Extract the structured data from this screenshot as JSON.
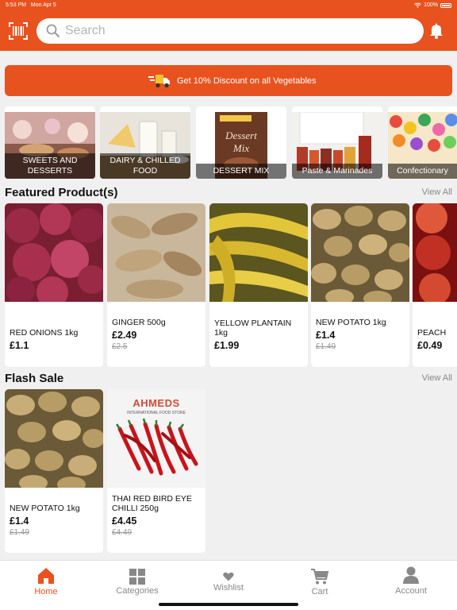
{
  "status": {
    "time": "5:53 PM",
    "date": "Mon Apr 5",
    "battery": "100%"
  },
  "search": {
    "placeholder": "Search"
  },
  "banner": {
    "text": "Get 10% Discount on all Vegetables"
  },
  "categories": [
    {
      "label": "SWEETS AND DESSERTS"
    },
    {
      "label": "DAIRY & CHILLED FOOD"
    },
    {
      "label": "DESSERT MIX"
    },
    {
      "label": "Paste & Marinades"
    },
    {
      "label": "Confectionary"
    }
  ],
  "featured": {
    "title": "Featured Product(s)",
    "view_all": "View All",
    "products": [
      {
        "name": "RED ONIONS 1kg",
        "price": "£1.1",
        "old_price": ""
      },
      {
        "name": "GINGER 500g",
        "price": "£2.49",
        "old_price": "£2.5"
      },
      {
        "name": "YELLOW PLANTAIN 1kg",
        "price": "£1.99",
        "old_price": ""
      },
      {
        "name": "NEW POTATO 1kg",
        "price": "£1.4",
        "old_price": "£1.49"
      },
      {
        "name": "PEACH",
        "price": "£0.49",
        "old_price": ""
      }
    ]
  },
  "flash_sale": {
    "title": "Flash Sale",
    "view_all": "View All",
    "products": [
      {
        "name": "NEW POTATO 1kg",
        "price": "£1.4",
        "old_price": "£1.49"
      },
      {
        "name": "THAI RED BIRD EYE CHILLI 250g",
        "price": "£4.45",
        "old_price": "£4.49",
        "image_text": "AHMEDS",
        "image_subtext": "INTERNATIONAL FOOD STORE"
      }
    ]
  },
  "nav": {
    "home": "Home",
    "categories": "Categories",
    "wishlist": "Wishlist",
    "cart": "Cart",
    "account": "Account"
  },
  "colors": {
    "brand": "#e8521f",
    "background": "#f0f0f0"
  }
}
